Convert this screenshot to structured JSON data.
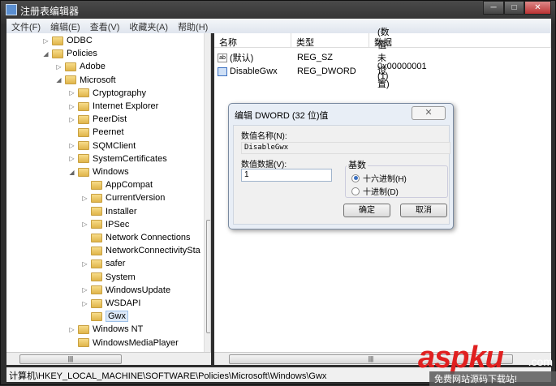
{
  "window": {
    "title": "注册表编辑器",
    "min": "─",
    "max": "□",
    "close": "✕"
  },
  "menu": [
    "文件(F)",
    "编辑(E)",
    "查看(V)",
    "收藏夹(A)",
    "帮助(H)"
  ],
  "tree": [
    {
      "label": "ODBC",
      "level": 3,
      "exp": "▷"
    },
    {
      "label": "Policies",
      "level": 3,
      "exp": "◢"
    },
    {
      "label": "Adobe",
      "level": 4,
      "exp": "▷"
    },
    {
      "label": "Microsoft",
      "level": 4,
      "exp": "◢"
    },
    {
      "label": "Cryptography",
      "level": 5,
      "exp": "▷"
    },
    {
      "label": "Internet Explorer",
      "level": 5,
      "exp": "▷"
    },
    {
      "label": "PeerDist",
      "level": 5,
      "exp": "▷"
    },
    {
      "label": "Peernet",
      "level": 5,
      "exp": ""
    },
    {
      "label": "SQMClient",
      "level": 5,
      "exp": "▷"
    },
    {
      "label": "SystemCertificates",
      "level": 5,
      "exp": "▷"
    },
    {
      "label": "Windows",
      "level": 5,
      "exp": "◢"
    },
    {
      "label": "AppCompat",
      "level": 6,
      "exp": ""
    },
    {
      "label": "CurrentVersion",
      "level": 6,
      "exp": "▷"
    },
    {
      "label": "Installer",
      "level": 6,
      "exp": ""
    },
    {
      "label": "IPSec",
      "level": 6,
      "exp": "▷"
    },
    {
      "label": "Network Connections",
      "level": 6,
      "exp": ""
    },
    {
      "label": "NetworkConnectivitySta",
      "level": 6,
      "exp": ""
    },
    {
      "label": "safer",
      "level": 6,
      "exp": "▷"
    },
    {
      "label": "System",
      "level": 6,
      "exp": ""
    },
    {
      "label": "WindowsUpdate",
      "level": 6,
      "exp": "▷"
    },
    {
      "label": "WSDAPI",
      "level": 6,
      "exp": "▷"
    },
    {
      "label": "Gwx",
      "level": 6,
      "exp": "",
      "selected": true
    },
    {
      "label": "Windows NT",
      "level": 5,
      "exp": "▷"
    },
    {
      "label": "WindowsMediaPlayer",
      "level": 5,
      "exp": ""
    }
  ],
  "list": {
    "headers": [
      "名称",
      "类型",
      "数据"
    ],
    "rows": [
      {
        "icon": "ab",
        "name": "(默认)",
        "type": "REG_SZ",
        "data": "(数值未设置)"
      },
      {
        "icon": "bin",
        "name": "DisableGwx",
        "type": "REG_DWORD",
        "data": "0x00000001 (1)"
      }
    ]
  },
  "status": "计算机\\HKEY_LOCAL_MACHINE\\SOFTWARE\\Policies\\Microsoft\\Windows\\Gwx",
  "dialog": {
    "title": "编辑 DWORD (32 位)值",
    "close": "✕",
    "name_label": "数值名称(N):",
    "name_value": "DisableGwx",
    "data_label": "数值数据(V):",
    "data_value": "1",
    "base_label": "基数",
    "hex": "十六进制(H)",
    "dec": "十进制(D)",
    "ok": "确定",
    "cancel": "取消",
    "selected_base": "hex"
  },
  "watermark": {
    "brand": "aspku",
    "tld": ".com",
    "slogan": "免费网站源码下载站!"
  }
}
